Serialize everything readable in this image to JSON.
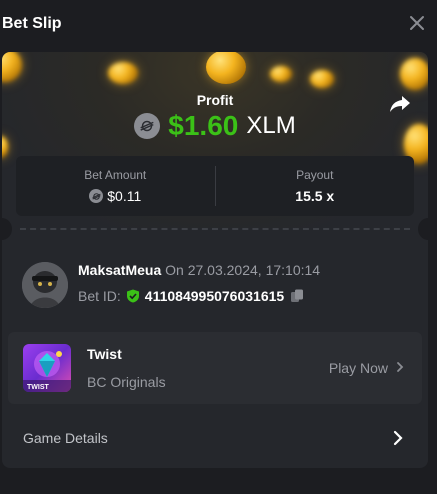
{
  "header": {
    "title": "Bet Slip",
    "close_icon": "close-icon"
  },
  "profit": {
    "label": "Profit",
    "amount": "$1.60",
    "currency": "XLM",
    "amount_color": "#3bc117"
  },
  "bet": {
    "amount_label": "Bet Amount",
    "amount_value": "$0.11",
    "payout_label": "Payout",
    "payout_value": "15.5 x"
  },
  "user": {
    "name": "MaksatMeua",
    "date": "On 27.03.2024, 17:10:14",
    "bet_id_label": "Bet ID:",
    "bet_id": "411084995076031615"
  },
  "game": {
    "name": "Twist",
    "provider": "BC Originals",
    "play_label": "Play Now",
    "thumb_label": "TWIST"
  },
  "details": {
    "label": "Game Details"
  },
  "colors": {
    "background": "#1c1d21",
    "card": "#25272c",
    "accent_green": "#3bc117"
  }
}
